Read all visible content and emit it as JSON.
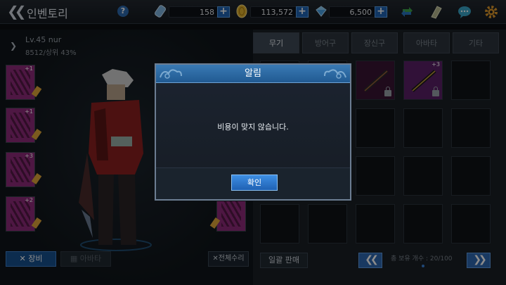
{
  "header": {
    "title": "인벤토리",
    "stamina": "158",
    "gold": "113,572",
    "gems": "6,500",
    "help_icon": "?"
  },
  "character": {
    "level_name": "Lv.45 nur",
    "sub_info": "8512/상위 43%"
  },
  "equip_slots": [
    {
      "plus": "+1"
    },
    {
      "plus": "+1"
    },
    {
      "plus": "+3"
    },
    {
      "plus": "+2"
    }
  ],
  "left_buttons": {
    "equip": "장비",
    "avatar": "아바타",
    "repair_all": "전체수리"
  },
  "tabs": [
    {
      "label": "무기",
      "active": true
    },
    {
      "label": "방어구",
      "active": false
    },
    {
      "label": "장신구",
      "active": false
    },
    {
      "label": "아바타",
      "active": false
    },
    {
      "label": "기타",
      "active": false
    }
  ],
  "inventory": {
    "bulk_sell": "일괄 판매",
    "count_text": "총 보유 개수 : 20/100",
    "item_plus": "+3"
  },
  "dialog": {
    "title": "알림",
    "message": "비용이 맞지 않습니다.",
    "confirm": "확인"
  },
  "colors": {
    "accent": "#1f64b5",
    "slot_bg": "#8f2a7a",
    "dialog_header": "#2d6ba4"
  }
}
